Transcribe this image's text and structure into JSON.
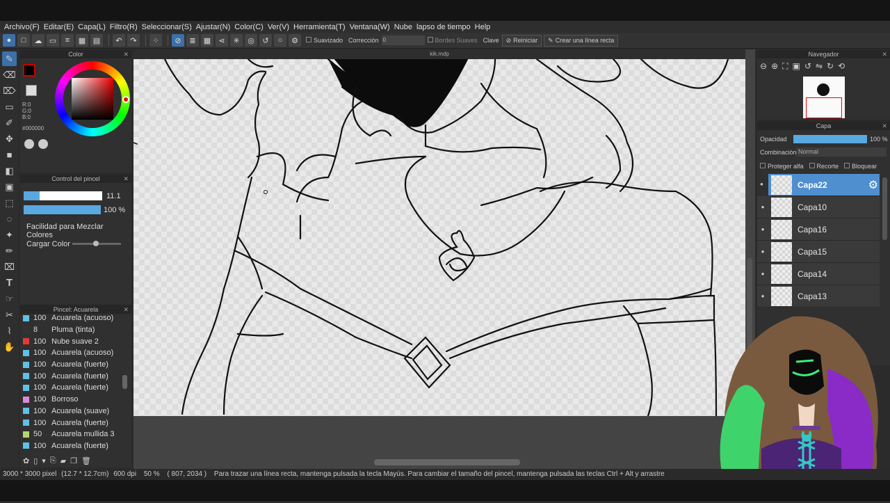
{
  "menu": [
    "Archivo(F)",
    "Editar(E)",
    "Capa(L)",
    "Filtro(R)",
    "Seleccionar(S)",
    "Ajustar(N)",
    "Color(C)",
    "Ver(V)",
    "Herramienta(T)",
    "Ventana(W)",
    "Nube",
    "lapso de tiempo",
    "Help"
  ],
  "toolbar": {
    "smoothing_label": "Suavizado",
    "correction_label": "Corrección",
    "correction_value": "0",
    "soft_edges_label": "Bordes Suaves",
    "key_label": "Clave",
    "reset_label": "Reiniciar",
    "straight_line_label": "Crear una línea recta"
  },
  "color_panel": {
    "title": "Color",
    "r": "R:0",
    "g": "G:0",
    "b": "B:0",
    "hex": "#000000",
    "primary_color": "#000000",
    "secondary_color": "#cc0000"
  },
  "brush_control": {
    "title": "Control del pincel",
    "size_value": "11.1",
    "opacity_value": "100 %",
    "mix_label": "Facilidad para Mezclar Colores",
    "load_label": "Cargar Color"
  },
  "brush_panel": {
    "title": "Pincel: Acuarela",
    "items": [
      {
        "size": "100",
        "name": "Acuarela (acuoso)",
        "color": "#5fc1e8"
      },
      {
        "size": "8",
        "name": "Pluma (tinta)",
        "color": "#333333"
      },
      {
        "size": "100",
        "name": "Nube suave 2",
        "color": "#e23a3a"
      },
      {
        "size": "100",
        "name": "Acuarela (acuoso)",
        "color": "#5fc1e8"
      },
      {
        "size": "100",
        "name": "Acuarela (fuerte)",
        "color": "#5fc1e8"
      },
      {
        "size": "100",
        "name": "Acuarela (fuerte)",
        "color": "#5fc1e8"
      },
      {
        "size": "100",
        "name": "Acuarela (fuerte)",
        "color": "#5fc1e8"
      },
      {
        "size": "100",
        "name": "Borroso",
        "color": "#d98bd8"
      },
      {
        "size": "100",
        "name": "Acuarela (suave)",
        "color": "#5fc1e8"
      },
      {
        "size": "100",
        "name": "Acuarela (fuerte)",
        "color": "#5fc1e8"
      },
      {
        "size": "50",
        "name": "Acuarela mullida 3",
        "color": "#b3d86a"
      },
      {
        "size": "100",
        "name": "Acuarela (fuerte)",
        "color": "#5fc1e8"
      }
    ]
  },
  "document": {
    "tab_title": "kik.mdp"
  },
  "navigator": {
    "title": "Navegador"
  },
  "layer_panel": {
    "title": "Capa",
    "opacity_label": "Opacidad",
    "opacity_value": "100 %",
    "blend_label": "Combinación",
    "blend_value": "Normal",
    "protect_alpha": "Proteger alfa",
    "clip": "Recorte",
    "lock": "Bloquear",
    "layers": [
      "Capa22",
      "Capa10",
      "Capa16",
      "Capa15",
      "Capa14",
      "Capa13"
    ]
  },
  "status": {
    "size": "3000 * 3000 pixel",
    "cm": "(12.7 * 12.7cm)",
    "dpi": "600 dpi",
    "zoom": "50 %",
    "coords": "( 807, 2034 )",
    "hint": "Para trazar una línea recta, mantenga pulsada la tecla Mayús. Para cambiar el tamaño del pincel, mantenga pulsada las teclas Ctrl + Alt y arrastre"
  }
}
